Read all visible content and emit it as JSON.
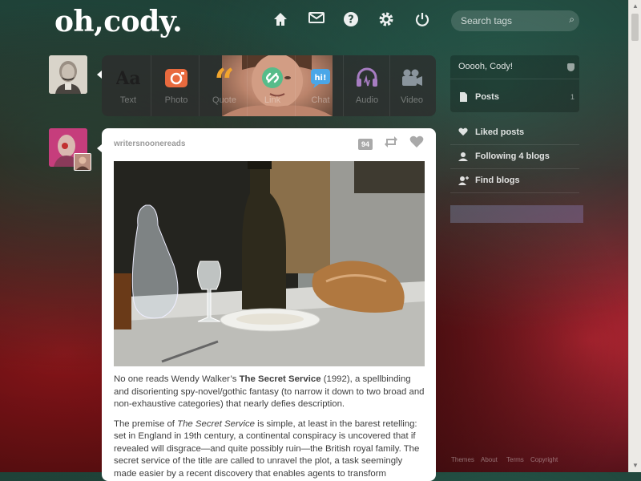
{
  "header": {
    "logo": "oh,cody.",
    "nav_icons": [
      "home-icon",
      "mail-icon",
      "help-icon",
      "gear-icon",
      "power-icon"
    ],
    "search": {
      "placeholder": "Search tags"
    }
  },
  "post_types": [
    {
      "label": "Text",
      "icon": "text-icon",
      "color": "#2c2c2c"
    },
    {
      "label": "Photo",
      "icon": "camera-icon",
      "color": "#e86a3e"
    },
    {
      "label": "Quote",
      "icon": "quote-icon",
      "color": "#f2a52d"
    },
    {
      "label": "Link",
      "icon": "link-icon",
      "color": "#56bc8a"
    },
    {
      "label": "Chat",
      "icon": "chat-icon",
      "color": "#4aa6e8"
    },
    {
      "label": "Audio",
      "icon": "headphones-icon",
      "color": "#a77dc2"
    },
    {
      "label": "Video",
      "icon": "video-icon",
      "color": "#748089"
    }
  ],
  "post": {
    "author": "writersnoonereads",
    "notes": "94",
    "body_p1_start": "No one reads Wendy Walker’s ",
    "body_p1_title": "The Secret Service",
    "body_p1_end": " (1992), a spellbinding and disorienting spy-novel/gothic fantasy (to narrow it down to two broad and non-exhaustive categories) that nearly defies description.",
    "body_p2_start": "The premise of ",
    "body_p2_title": "The Secret Service",
    "body_p2_end": " is simple, at least in the barest retelling: set in England in 19th century, a continental conspiracy is uncovered that if revealed will disgrace—and quite possibly ruin—the British royal family. The secret service of the title are called to unravel the plot, a task seemingly made easier by a recent discovery that enables agents to transform themselves into"
  },
  "sidebar": {
    "blog_title": "Ooooh, Cody!",
    "posts_label": "Posts",
    "posts_count": "1",
    "liked_label": "Liked posts",
    "following_label": "Following 4 blogs",
    "find_label": "Find blogs"
  },
  "footer": {
    "themes": "Themes",
    "about": "About",
    "terms": "Terms",
    "copyright": "Copyright"
  }
}
